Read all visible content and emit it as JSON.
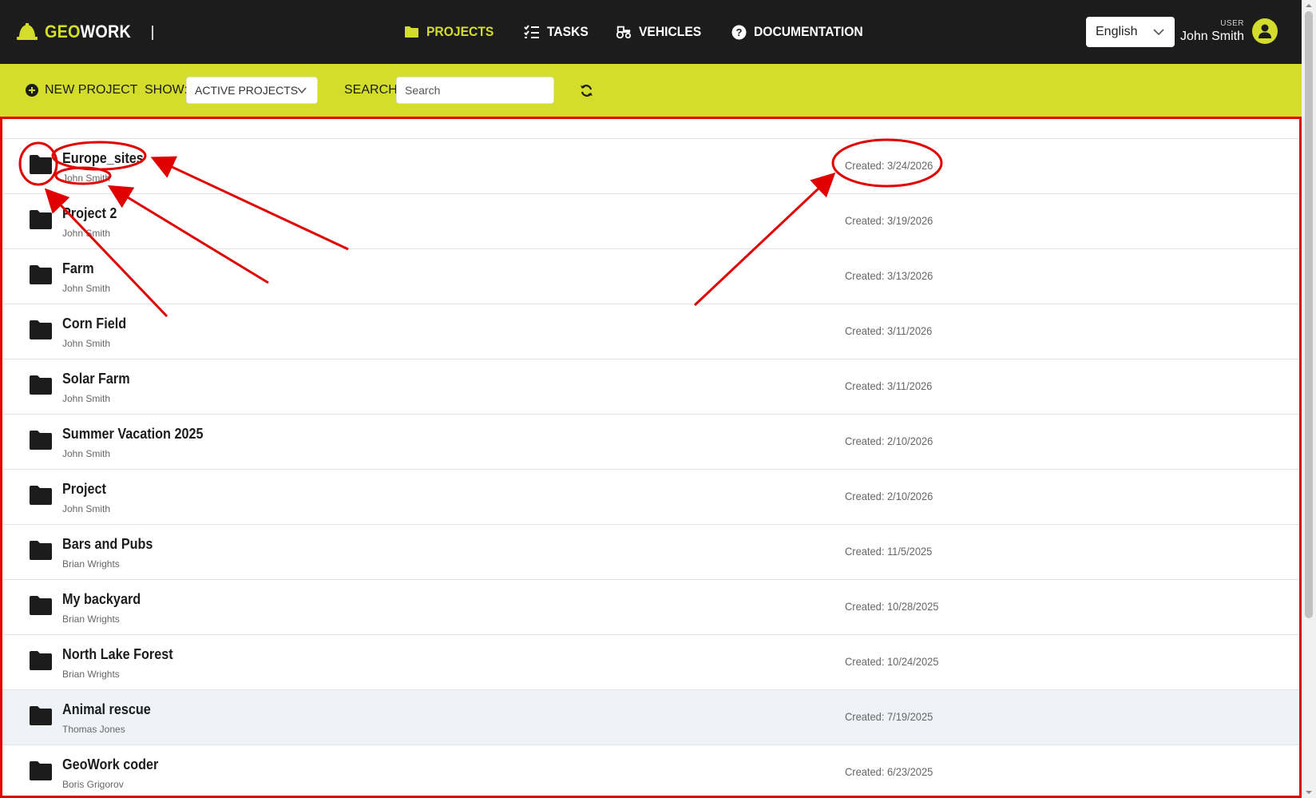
{
  "app": {
    "logo_geo": "GEO",
    "logo_work": "WORK"
  },
  "nav": {
    "items": [
      {
        "label": "PROJECTS",
        "icon": "folder-icon",
        "active": true
      },
      {
        "label": "TASKS",
        "icon": "tasks-list-icon",
        "active": false
      },
      {
        "label": "VEHICLES",
        "icon": "tractor-icon",
        "active": false
      },
      {
        "label": "DOCUMENTATION",
        "icon": "question-circle-icon",
        "active": false
      }
    ]
  },
  "language": {
    "selected": "English"
  },
  "user": {
    "role": "USER",
    "name": "John Smith"
  },
  "toolbar": {
    "new_project_label": "NEW PROJECT",
    "show_label": "SHOW:",
    "show_selected": "ACTIVE PROJECTS",
    "search_label": "SEARCH:",
    "search_placeholder": "Search"
  },
  "projects": [
    {
      "name": "Europe_sites",
      "owner": "John Smith",
      "created": "Created: 3/24/2026"
    },
    {
      "name": "Project 2",
      "owner": "John Smith",
      "created": "Created: 3/19/2026"
    },
    {
      "name": "Farm",
      "owner": "John Smith",
      "created": "Created: 3/13/2026"
    },
    {
      "name": "Corn Field",
      "owner": "John Smith",
      "created": "Created: 3/11/2026"
    },
    {
      "name": "Solar Farm",
      "owner": "John Smith",
      "created": "Created: 3/11/2026"
    },
    {
      "name": "Summer Vacation 2025",
      "owner": "John Smith",
      "created": "Created: 2/10/2026"
    },
    {
      "name": "Project",
      "owner": "John Smith",
      "created": "Created: 2/10/2026"
    },
    {
      "name": "Bars and Pubs",
      "owner": "Brian Wrights",
      "created": "Created: 11/5/2025"
    },
    {
      "name": "My backyard",
      "owner": "Brian Wrights",
      "created": "Created: 10/28/2025"
    },
    {
      "name": "North Lake Forest",
      "owner": "Brian Wrights",
      "created": "Created: 10/24/2025"
    },
    {
      "name": "Animal rescue",
      "owner": "Thomas Jones",
      "created": "Created: 7/19/2025",
      "highlighted": true
    },
    {
      "name": "GeoWork coder",
      "owner": "Boris Grigorov",
      "created": "Created: 6/23/2025"
    }
  ],
  "colors": {
    "topbar": "#1c1c1c",
    "accent": "#d4dd2b",
    "annotation": "#e00000"
  }
}
